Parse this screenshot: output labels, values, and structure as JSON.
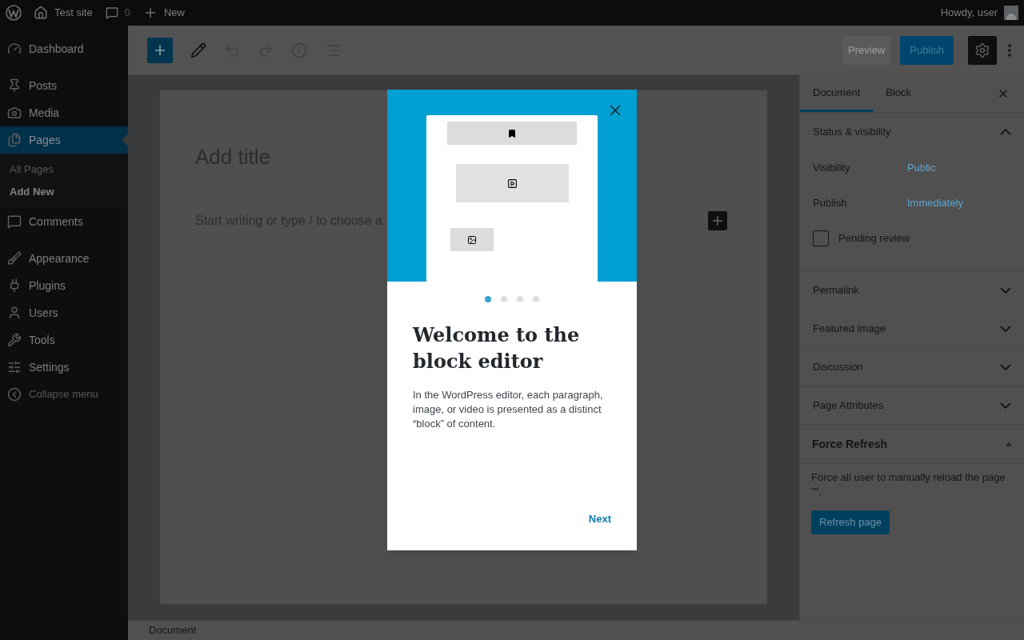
{
  "admin_bar": {
    "site": "Test site",
    "comments": "0",
    "new": "New",
    "greeting": "Howdy, user"
  },
  "menu": [
    {
      "label": "Dashboard",
      "selected": false
    },
    {
      "label": "Posts",
      "selected": false
    },
    {
      "label": "Media",
      "selected": false
    },
    {
      "label": "Pages",
      "selected": true,
      "children": [
        {
          "label": "All Pages",
          "selected": false
        },
        {
          "label": "Add New",
          "selected": true
        }
      ]
    },
    {
      "label": "Comments",
      "selected": false
    },
    {
      "label": "Appearance",
      "selected": false
    },
    {
      "label": "Plugins",
      "selected": false
    },
    {
      "label": "Users",
      "selected": false
    },
    {
      "label": "Tools",
      "selected": false
    },
    {
      "label": "Settings",
      "selected": false
    }
  ],
  "collapse": "Collapse menu",
  "toolbar": {
    "preview": "Preview",
    "publish": "Publish"
  },
  "editor": {
    "title_placeholder": "Add title",
    "body_placeholder": "Start writing or type / to choose a"
  },
  "tabs": [
    {
      "label": "Document",
      "selected": true
    },
    {
      "label": "Block",
      "selected": false
    }
  ],
  "panels": [
    {
      "kind": "section",
      "title": "Status & visibility",
      "expanded": true,
      "rows": [
        {
          "label": "Visibility",
          "value": "Public"
        },
        {
          "label": "Publish",
          "value": "Immediately"
        }
      ],
      "checkbox": {
        "label": "Pending review",
        "checked": false
      }
    },
    {
      "kind": "section",
      "title": "Permalink",
      "expanded": false
    },
    {
      "kind": "section",
      "title": "Featured image",
      "expanded": false
    },
    {
      "kind": "section",
      "title": "Discussion",
      "expanded": false
    },
    {
      "kind": "section",
      "title": "Page Attributes",
      "expanded": false
    },
    {
      "kind": "plugin",
      "title": "Force Refresh",
      "expanded": true,
      "text": "Force all user to manually reload the page \"\".",
      "button": "Refresh page"
    }
  ],
  "guide": {
    "dots": [
      {
        "selected": true
      },
      {
        "selected": false
      },
      {
        "selected": false
      },
      {
        "selected": false
      }
    ],
    "heading": "Welcome to the block editor",
    "text": "In the WordPress editor, each paragraph, image, or video is presented as a distinct “block” of content.",
    "next": "Next"
  },
  "footer": "Document"
}
